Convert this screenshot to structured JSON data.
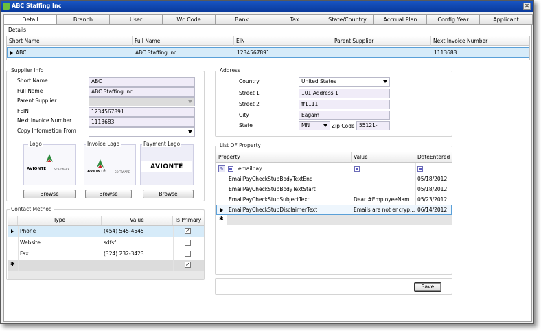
{
  "window": {
    "title": "ABC Staffing Inc",
    "close_glyph": "✕"
  },
  "tabs": [
    "Detail",
    "Branch",
    "User",
    "Wc Code",
    "Bank",
    "Tax",
    "State/Country",
    "Accrual Plan",
    "Config Year",
    "Applicant"
  ],
  "details": {
    "legend": "Details",
    "columns": [
      "Short Name",
      "Full Name",
      "EIN",
      "Parent Supplier",
      "Next Invoice Number"
    ],
    "row": {
      "short_name": "ABC",
      "full_name": "ABC Staffing Inc",
      "ein": "1234567891",
      "parent_supplier": "",
      "next_invoice": "1113683"
    }
  },
  "supplier_info": {
    "legend": "Supplier Info",
    "labels": {
      "short_name": "Short Name",
      "full_name": "Full Name",
      "parent_supplier": "Parent Supplier",
      "fein": "FEIN",
      "next_invoice": "Next Invoice Number",
      "copy_info": "Copy Information From"
    },
    "values": {
      "short_name": "ABC",
      "full_name": "ABC Staffing Inc",
      "parent_supplier": "",
      "fein": "1234567891",
      "next_invoice": "1113683",
      "copy_info": ""
    },
    "logos": [
      {
        "legend": "Logo",
        "brand": "AVIONTÉ",
        "sub": "SOFTWARE",
        "button": "Browse"
      },
      {
        "legend": "Invoice Logo",
        "brand": "AVIONTÉ",
        "sub": "SOFTWARE",
        "button": "Browse"
      },
      {
        "legend": "Payment Logo",
        "brand": "AVIONTÉ",
        "button": "Browse"
      }
    ]
  },
  "address": {
    "legend": "Address",
    "labels": {
      "country": "Country",
      "street1": "Street 1",
      "street2": "Street 2",
      "city": "City",
      "state": "State",
      "zip": "Zip Code"
    },
    "values": {
      "country": "United States",
      "street1": "101 Address 1",
      "street2": "ff1111",
      "city": "Eagam",
      "state": "MN",
      "zip": "55121-"
    }
  },
  "contact_method": {
    "legend": "Contact Method",
    "columns": [
      "Type",
      "Value",
      "Is Primary"
    ],
    "rows": [
      {
        "type": "Phone",
        "value": "(454) 545-4545",
        "primary": true
      },
      {
        "type": "Website",
        "value": "sdfsf",
        "primary": false
      },
      {
        "type": "Fax",
        "value": "(324) 232-3423",
        "primary": false
      }
    ],
    "new_row_primary": true,
    "new_row_marker": "✱"
  },
  "list_of_property": {
    "legend": "List OF Property",
    "columns": [
      "Property",
      "Value",
      "DateEntered"
    ],
    "rows": [
      {
        "property": "emailpay",
        "value": "",
        "date": ""
      },
      {
        "property": "EmailPayCheckStubBodyTextEnd",
        "value": "",
        "date": "05/18/2012"
      },
      {
        "property": "EmailPayCheckStubBodyTextStart",
        "value": "",
        "date": "05/18/2012"
      },
      {
        "property": "EmailPayCheckStubSubjectText",
        "value": "Dear #EmployeeNam...",
        "date": "05/23/2012"
      },
      {
        "property": "EmailPayCheckStubDisclaimerText",
        "value": "Emails are not encryp...",
        "date": "06/14/2012"
      }
    ],
    "new_row_marker": "✱"
  },
  "save_button": "Save",
  "colors": {
    "title_bar": "#0a3a9c",
    "selection": "#d6ebf9",
    "field_fill": "#f0ecf8"
  }
}
